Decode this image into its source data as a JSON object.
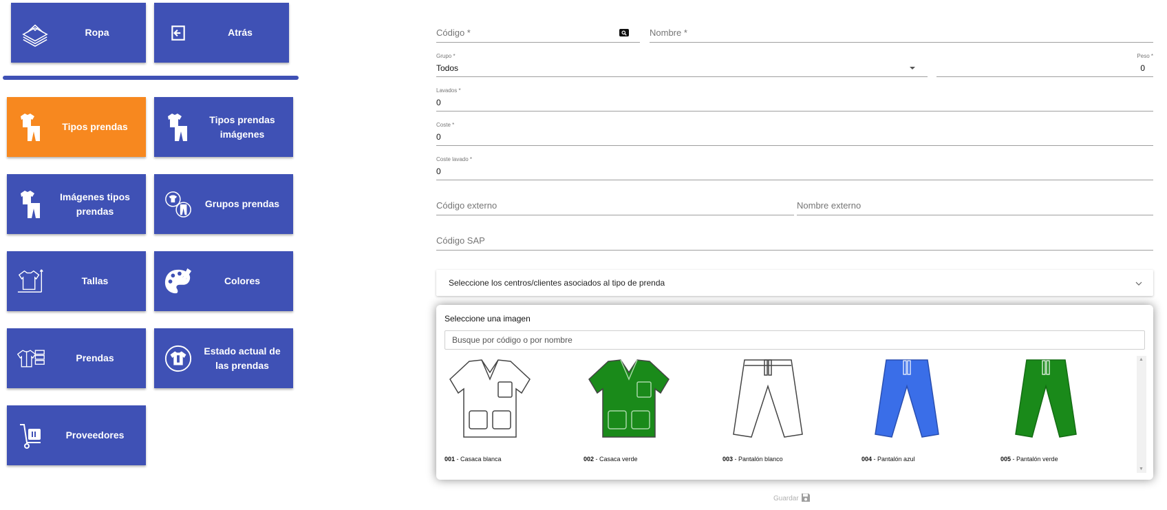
{
  "menu": {
    "top": [
      {
        "label": "Ropa",
        "icon": "clothes-stack-icon"
      },
      {
        "label": "Atrás",
        "icon": "exit-back-icon"
      }
    ],
    "items": [
      {
        "label": "Tipos prendas",
        "icon": "garment-types-icon",
        "active": true
      },
      {
        "label": "Tipos prendas imágenes",
        "icon": "garment-types-images-icon"
      },
      {
        "label": "Imágenes tipos prendas",
        "icon": "garment-images-icon"
      },
      {
        "label": "Grupos prendas",
        "icon": "garment-groups-icon"
      },
      {
        "label": "Tallas",
        "icon": "sizes-icon"
      },
      {
        "label": "Colores",
        "icon": "palette-icon"
      },
      {
        "label": "Prendas",
        "icon": "garments-icon"
      },
      {
        "label": "Estado actual de las prendas",
        "icon": "garment-status-icon"
      },
      {
        "label": "Proveedores",
        "icon": "suppliers-icon"
      }
    ]
  },
  "form": {
    "codigo": {
      "label": "Código *",
      "value": ""
    },
    "nombre": {
      "label": "Nombre *",
      "value": ""
    },
    "grupo": {
      "label": "Grupo *",
      "value": "Todos"
    },
    "peso": {
      "label": "Peso *",
      "value": "0"
    },
    "lavados": {
      "label": "Lavados *",
      "value": "0"
    },
    "coste": {
      "label": "Coste *",
      "value": "0"
    },
    "coste_lavado": {
      "label": "Coste lavado *",
      "value": "0"
    },
    "codigo_externo": {
      "label": "Código externo",
      "value": ""
    },
    "nombre_externo": {
      "label": "Nombre externo",
      "value": ""
    },
    "codigo_sap": {
      "label": "Código SAP",
      "value": ""
    },
    "centros_expander": "Seleccione los centros/clientes asociados al tipo de prenda",
    "save_label": "Guardar"
  },
  "image_picker": {
    "title": "Seleccione una imagen",
    "search_placeholder": "Busque por código o por nombre",
    "images": [
      {
        "code": "001",
        "name": " - Casaca blanca",
        "kind": "shirt",
        "color": "#ffffff"
      },
      {
        "code": "002",
        "name": " - Casaca verde",
        "kind": "shirt",
        "color": "#1a8a1a"
      },
      {
        "code": "003",
        "name": " - Pantalón blanco",
        "kind": "pants",
        "color": "#ffffff"
      },
      {
        "code": "004",
        "name": " - Pantalón azul",
        "kind": "pants",
        "color": "#3a6ee8"
      },
      {
        "code": "005",
        "name": " - Pantalón verde",
        "kind": "pants",
        "color": "#1a8a1a"
      }
    ]
  },
  "colors": {
    "primary": "#3f51b5",
    "active": "#f7881f"
  }
}
